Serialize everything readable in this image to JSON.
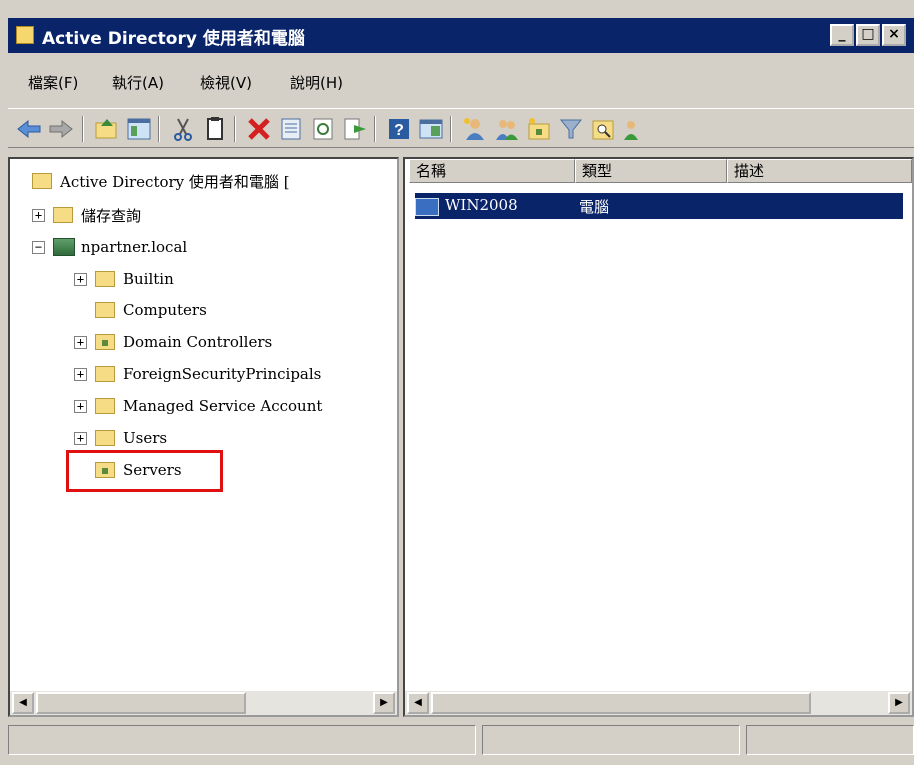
{
  "window": {
    "title": "Active Directory 使用者和電腦"
  },
  "menu": [
    "檔案(F)",
    "執行(A)",
    "檢視(V)",
    "說明(H)"
  ],
  "toolbar_icons": [
    "back-icon",
    "forward-icon",
    "up-folder-icon",
    "show-console-tree-icon",
    "cut-icon",
    "copy-icon",
    "delete-icon",
    "properties-icon",
    "refresh-icon",
    "export-list-icon",
    "help-icon",
    "show-action-pane-icon",
    "new-user-icon",
    "new-group-icon",
    "new-ou-icon",
    "filter-icon",
    "find-icon",
    "add-to-group-icon"
  ],
  "tree": {
    "root": "Active Directory 使用者和電腦 [",
    "saved_queries": "儲存查詢",
    "domain": "npartner.local",
    "children": [
      "Builtin",
      "Computers",
      "Domain Controllers",
      "ForeignSecurityPrincipals",
      "Managed Service Account",
      "Users",
      "Servers"
    ]
  },
  "list": {
    "columns": [
      "名稱",
      "類型",
      "描述"
    ],
    "rows": [
      {
        "name": "WIN2008",
        "type": "電腦",
        "description": ""
      }
    ]
  }
}
